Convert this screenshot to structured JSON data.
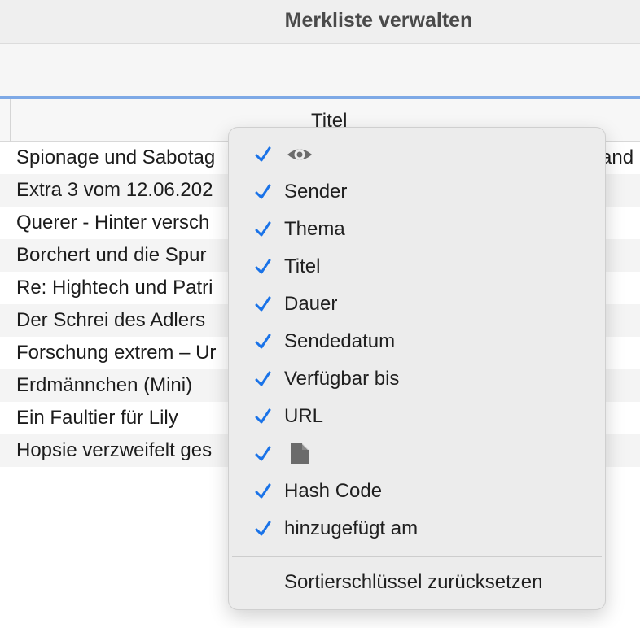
{
  "window": {
    "title": "Merkliste verwalten"
  },
  "table": {
    "column_header": "Titel",
    "rows": [
      {
        "title": "Spionage und Sabotag",
        "right": "and"
      },
      {
        "title": "Extra 3 vom 12.06.202",
        "right": ""
      },
      {
        "title": "Querer - Hinter versch",
        "right": ""
      },
      {
        "title": "Borchert und die Spur",
        "right": ""
      },
      {
        "title": "Re: Hightech und Patri",
        "right": ""
      },
      {
        "title": "Der Schrei des Adlers",
        "right": ""
      },
      {
        "title": "Forschung extrem – Ur",
        "right": ""
      },
      {
        "title": "Erdmännchen (Mini)",
        "right": ""
      },
      {
        "title": "Ein Faultier für Lily",
        "right": ""
      },
      {
        "title": "Hopsie verzweifelt ges",
        "right": ""
      }
    ]
  },
  "context_menu": {
    "items": [
      {
        "icon": "eye-icon",
        "label": "",
        "checked": true
      },
      {
        "icon": "",
        "label": "Sender",
        "checked": true
      },
      {
        "icon": "",
        "label": "Thema",
        "checked": true
      },
      {
        "icon": "",
        "label": "Titel",
        "checked": true
      },
      {
        "icon": "",
        "label": "Dauer",
        "checked": true
      },
      {
        "icon": "",
        "label": "Sendedatum",
        "checked": true
      },
      {
        "icon": "",
        "label": "Verfügbar bis",
        "checked": true
      },
      {
        "icon": "",
        "label": "URL",
        "checked": true
      },
      {
        "icon": "document-icon",
        "label": "",
        "checked": true
      },
      {
        "icon": "",
        "label": "Hash Code",
        "checked": true
      },
      {
        "icon": "",
        "label": "hinzugefügt am",
        "checked": true
      }
    ],
    "reset_label": "Sortierschlüssel zurücksetzen"
  },
  "colors": {
    "accent_blue": "#1a73e8",
    "focus_line": "#7ea9e6",
    "menu_background": "#ececec",
    "row_stripe": "#f4f4f4"
  }
}
